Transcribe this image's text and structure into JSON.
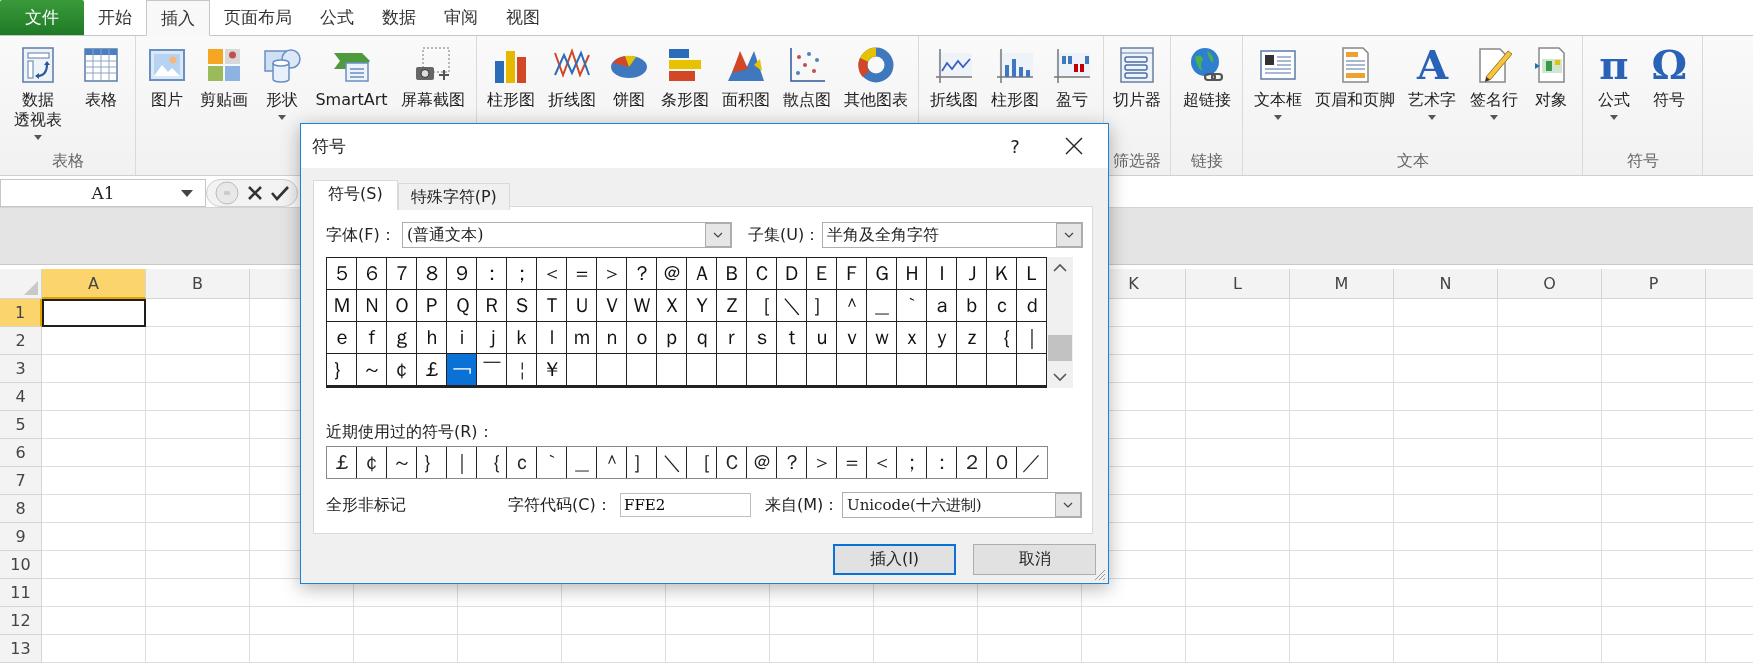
{
  "menu_tabs": [
    {
      "label": "文件",
      "kind": "file",
      "selected": false
    },
    {
      "label": "开始",
      "kind": "tab",
      "selected": false
    },
    {
      "label": "插入",
      "kind": "tab",
      "selected": true
    },
    {
      "label": "页面布局",
      "kind": "tab",
      "selected": false
    },
    {
      "label": "公式",
      "kind": "tab",
      "selected": false
    },
    {
      "label": "数据",
      "kind": "tab",
      "selected": false
    },
    {
      "label": "审阅",
      "kind": "tab",
      "selected": false
    },
    {
      "label": "视图",
      "kind": "tab",
      "selected": false
    }
  ],
  "ribbon": {
    "groups": [
      {
        "label": "表格",
        "buttons": [
          {
            "label_lines": [
              "数据",
              "透视表"
            ],
            "dropdown": true
          },
          {
            "label": "表格",
            "dropdown": false
          }
        ]
      },
      {
        "buttons": [
          {
            "label": "图片",
            "dropdown": false
          },
          {
            "label": "剪贴画",
            "dropdown": false
          },
          {
            "label": "形状",
            "dropdown": true
          },
          {
            "label": "SmartArt",
            "dropdown": false
          },
          {
            "label": "屏幕截图",
            "dropdown": false
          }
        ]
      },
      {
        "buttons": [
          {
            "label": "柱形图",
            "dropdown": false
          },
          {
            "label": "折线图",
            "dropdown": false
          },
          {
            "label": "饼图",
            "dropdown": false
          },
          {
            "label": "条形图",
            "dropdown": false
          },
          {
            "label": "面积图",
            "dropdown": false
          },
          {
            "label": "散点图",
            "dropdown": false
          },
          {
            "label": "其他图表",
            "dropdown": false
          }
        ]
      },
      {
        "buttons": [
          {
            "label": "折线图",
            "dropdown": false
          },
          {
            "label": "柱形图",
            "dropdown": false
          },
          {
            "label": "盈亏",
            "dropdown": false
          }
        ]
      },
      {
        "label": "筛选器",
        "buttons": [
          {
            "label": "切片器",
            "dropdown": false
          }
        ]
      },
      {
        "label": "链接",
        "buttons": [
          {
            "label": "超链接",
            "dropdown": false
          }
        ]
      },
      {
        "label": "文本",
        "buttons": [
          {
            "label": "文本框",
            "dropdown": true
          },
          {
            "label": "页眉和页脚",
            "dropdown": false
          },
          {
            "label": "艺术字",
            "glyph": "A",
            "dropdown": true
          },
          {
            "label": "签名行",
            "dropdown": true
          },
          {
            "label": "对象",
            "dropdown": false
          }
        ]
      },
      {
        "label": "符号",
        "buttons": [
          {
            "label": "公式",
            "glyph": "π",
            "dropdown": true
          },
          {
            "label": "符号",
            "glyph": "Ω",
            "dropdown": false
          }
        ]
      }
    ]
  },
  "formula_bar": {
    "name_box": "A1"
  },
  "sheet": {
    "columns_left": [
      {
        "label": "A",
        "selected": true
      },
      {
        "label": "B",
        "selected": false
      }
    ],
    "columns_right": [
      {
        "label": "K",
        "selected": false
      },
      {
        "label": "L",
        "selected": false
      },
      {
        "label": "M",
        "selected": false
      },
      {
        "label": "N",
        "selected": false
      },
      {
        "label": "O",
        "selected": false
      },
      {
        "label": "P",
        "selected": false
      }
    ],
    "rows": [
      {
        "label": "1",
        "selected": true
      },
      {
        "label": "2",
        "selected": false
      },
      {
        "label": "3",
        "selected": false
      },
      {
        "label": "4",
        "selected": false
      },
      {
        "label": "5",
        "selected": false
      },
      {
        "label": "6",
        "selected": false
      },
      {
        "label": "7",
        "selected": false
      },
      {
        "label": "8",
        "selected": false
      },
      {
        "label": "9",
        "selected": false
      },
      {
        "label": "10",
        "selected": false
      },
      {
        "label": "11",
        "selected": false
      },
      {
        "label": "12",
        "selected": false
      },
      {
        "label": "13",
        "selected": false
      }
    ]
  },
  "dialog": {
    "title": "符号",
    "help": "?",
    "tabs": [
      {
        "label": "符号(S)",
        "selected": true
      },
      {
        "label": "特殊字符(P)",
        "selected": false
      }
    ],
    "font_label": "字体(F)：",
    "font_value": "(普通文本)",
    "subset_label": "子集(U)：",
    "subset_value": "半角及全角字符",
    "symbols": [
      {
        "char": "５",
        "selected": false
      },
      {
        "char": "６",
        "selected": false
      },
      {
        "char": "７",
        "selected": false
      },
      {
        "char": "８",
        "selected": false
      },
      {
        "char": "９",
        "selected": false
      },
      {
        "char": "：",
        "selected": false
      },
      {
        "char": "；",
        "selected": false
      },
      {
        "char": "＜",
        "selected": false
      },
      {
        "char": "＝",
        "selected": false
      },
      {
        "char": "＞",
        "selected": false
      },
      {
        "char": "？",
        "selected": false
      },
      {
        "char": "＠",
        "selected": false
      },
      {
        "char": "Ａ",
        "selected": false
      },
      {
        "char": "Ｂ",
        "selected": false
      },
      {
        "char": "Ｃ",
        "selected": false
      },
      {
        "char": "Ｄ",
        "selected": false
      },
      {
        "char": "Ｅ",
        "selected": false
      },
      {
        "char": "Ｆ",
        "selected": false
      },
      {
        "char": "Ｇ",
        "selected": false
      },
      {
        "char": "Ｈ",
        "selected": false
      },
      {
        "char": "Ｉ",
        "selected": false
      },
      {
        "char": "Ｊ",
        "selected": false
      },
      {
        "char": "Ｋ",
        "selected": false
      },
      {
        "char": "Ｌ",
        "selected": false
      },
      {
        "char": "Ｍ",
        "selected": false
      },
      {
        "char": "Ｎ",
        "selected": false
      },
      {
        "char": "Ｏ",
        "selected": false
      },
      {
        "char": "Ｐ",
        "selected": false
      },
      {
        "char": "Ｑ",
        "selected": false
      },
      {
        "char": "Ｒ",
        "selected": false
      },
      {
        "char": "Ｓ",
        "selected": false
      },
      {
        "char": "Ｔ",
        "selected": false
      },
      {
        "char": "Ｕ",
        "selected": false
      },
      {
        "char": "Ｖ",
        "selected": false
      },
      {
        "char": "Ｗ",
        "selected": false
      },
      {
        "char": "Ｘ",
        "selected": false
      },
      {
        "char": "Ｙ",
        "selected": false
      },
      {
        "char": "Ｚ",
        "selected": false
      },
      {
        "char": "［",
        "selected": false
      },
      {
        "char": "＼",
        "selected": false
      },
      {
        "char": "］",
        "selected": false
      },
      {
        "char": "＾",
        "selected": false
      },
      {
        "char": "＿",
        "selected": false
      },
      {
        "char": "｀",
        "selected": false
      },
      {
        "char": "ａ",
        "selected": false
      },
      {
        "char": "ｂ",
        "selected": false
      },
      {
        "char": "ｃ",
        "selected": false
      },
      {
        "char": "ｄ",
        "selected": false
      },
      {
        "char": "ｅ",
        "selected": false
      },
      {
        "char": "ｆ",
        "selected": false
      },
      {
        "char": "ｇ",
        "selected": false
      },
      {
        "char": "ｈ",
        "selected": false
      },
      {
        "char": "ｉ",
        "selected": false
      },
      {
        "char": "ｊ",
        "selected": false
      },
      {
        "char": "ｋ",
        "selected": false
      },
      {
        "char": "ｌ",
        "selected": false
      },
      {
        "char": "ｍ",
        "selected": false
      },
      {
        "char": "ｎ",
        "selected": false
      },
      {
        "char": "ｏ",
        "selected": false
      },
      {
        "char": "ｐ",
        "selected": false
      },
      {
        "char": "ｑ",
        "selected": false
      },
      {
        "char": "ｒ",
        "selected": false
      },
      {
        "char": "ｓ",
        "selected": false
      },
      {
        "char": "ｔ",
        "selected": false
      },
      {
        "char": "ｕ",
        "selected": false
      },
      {
        "char": "ｖ",
        "selected": false
      },
      {
        "char": "ｗ",
        "selected": false
      },
      {
        "char": "ｘ",
        "selected": false
      },
      {
        "char": "ｙ",
        "selected": false
      },
      {
        "char": "ｚ",
        "selected": false
      },
      {
        "char": "｛",
        "selected": false
      },
      {
        "char": "｜",
        "selected": false
      },
      {
        "char": "｝",
        "selected": false
      },
      {
        "char": "～",
        "selected": false
      },
      {
        "char": "￠",
        "selected": false
      },
      {
        "char": "￡",
        "selected": false
      },
      {
        "char": "￢",
        "selected": true
      },
      {
        "char": "￣",
        "selected": false
      },
      {
        "char": "￤",
        "selected": false
      },
      {
        "char": "￥",
        "selected": false
      }
    ],
    "recent_label": "近期使用过的符号(R)：",
    "recent": [
      "￡",
      "￠",
      "～",
      "｝",
      "｜",
      "｛",
      "ｃ",
      "｀",
      "＿",
      "＾",
      "］",
      "＼",
      "［",
      "Ｃ",
      "＠",
      "？",
      "＞",
      "＝",
      "＜",
      "；",
      "：",
      "２",
      "０",
      "／"
    ],
    "description": "全形非标记",
    "code_label": "字符代码(C)：",
    "code_value": "FFE2",
    "from_label": "来自(M)：",
    "from_value": "Unicode(十六进制)",
    "buttons": [
      {
        "label": "插入(I)",
        "kind": "default"
      },
      {
        "label": "取消",
        "kind": "normal"
      }
    ]
  }
}
